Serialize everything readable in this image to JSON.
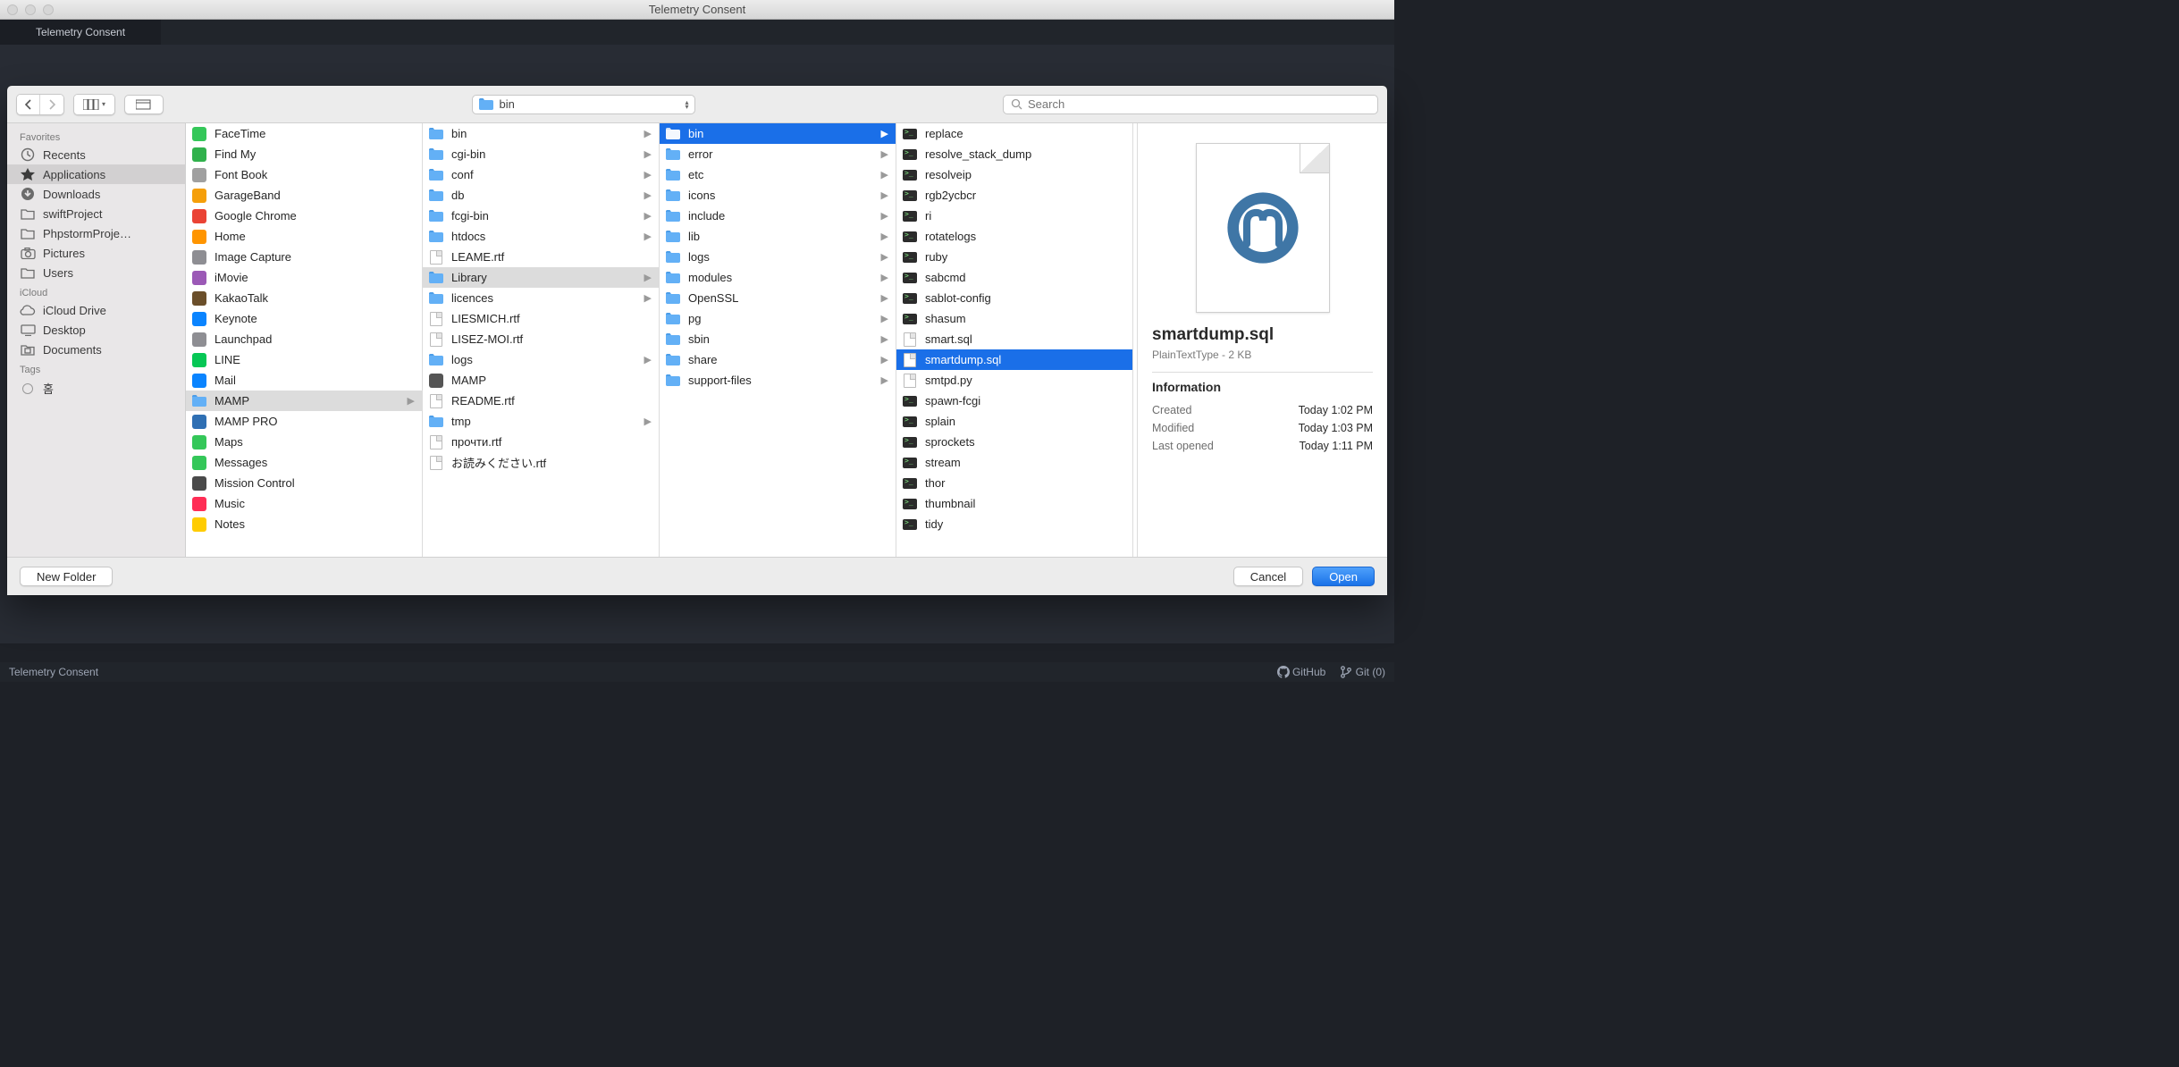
{
  "window": {
    "title": "Telemetry Consent"
  },
  "tabs": [
    {
      "label": "Telemetry Consent"
    }
  ],
  "statusbar": {
    "left": "Telemetry Consent",
    "github": "GitHub",
    "git": "Git (0)"
  },
  "dialog": {
    "path_dropdown": {
      "label": "bin"
    },
    "search": {
      "placeholder": "Search"
    },
    "sidebar": {
      "sections": [
        {
          "header": "Favorites",
          "items": [
            {
              "label": "Recents",
              "icon": "clock"
            },
            {
              "label": "Applications",
              "icon": "apps",
              "selected": true
            },
            {
              "label": "Downloads",
              "icon": "download"
            },
            {
              "label": "swiftProject",
              "icon": "folder"
            },
            {
              "label": "PhpstormProje…",
              "icon": "folder"
            },
            {
              "label": "Pictures",
              "icon": "camera"
            },
            {
              "label": "Users",
              "icon": "folder"
            }
          ]
        },
        {
          "header": "iCloud",
          "items": [
            {
              "label": "iCloud Drive",
              "icon": "cloud"
            },
            {
              "label": "Desktop",
              "icon": "desktop"
            },
            {
              "label": "Documents",
              "icon": "docfolder"
            }
          ]
        },
        {
          "header": "Tags",
          "items": [
            {
              "label": "홈",
              "icon": "tag"
            }
          ]
        }
      ]
    },
    "columns": [
      [
        {
          "label": "FaceTime",
          "type": "app",
          "color": "#34c759"
        },
        {
          "label": "Find My",
          "type": "app",
          "color": "#30b14c"
        },
        {
          "label": "Font Book",
          "type": "app",
          "color": "#a0a0a0"
        },
        {
          "label": "GarageBand",
          "type": "app",
          "color": "#f59f0a"
        },
        {
          "label": "Google Chrome",
          "type": "app",
          "color": "#ea4335"
        },
        {
          "label": "Home",
          "type": "app",
          "color": "#ff9500"
        },
        {
          "label": "Image Capture",
          "type": "app",
          "color": "#8e8e93"
        },
        {
          "label": "iMovie",
          "type": "app",
          "color": "#9b59b6"
        },
        {
          "label": "KakaoTalk",
          "type": "app",
          "color": "#6b4f2a"
        },
        {
          "label": "Keynote",
          "type": "app",
          "color": "#0a84ff"
        },
        {
          "label": "Launchpad",
          "type": "app",
          "color": "#8e8e93"
        },
        {
          "label": "LINE",
          "type": "app",
          "color": "#06c755"
        },
        {
          "label": "Mail",
          "type": "app",
          "color": "#0a84ff"
        },
        {
          "label": "MAMP",
          "type": "folder",
          "selected": "path",
          "hasChildren": true
        },
        {
          "label": "MAMP PRO",
          "type": "app",
          "color": "#2f6fb3"
        },
        {
          "label": "Maps",
          "type": "app",
          "color": "#34c759"
        },
        {
          "label": "Messages",
          "type": "app",
          "color": "#34c759"
        },
        {
          "label": "Mission Control",
          "type": "app",
          "color": "#4a4a4a"
        },
        {
          "label": "Music",
          "type": "app",
          "color": "#ff2d55"
        },
        {
          "label": "Notes",
          "type": "app",
          "color": "#ffcc00"
        }
      ],
      [
        {
          "label": "bin",
          "type": "folder",
          "hasChildren": true
        },
        {
          "label": "cgi-bin",
          "type": "folder",
          "hasChildren": true
        },
        {
          "label": "conf",
          "type": "folder",
          "hasChildren": true
        },
        {
          "label": "db",
          "type": "folder",
          "hasChildren": true
        },
        {
          "label": "fcgi-bin",
          "type": "folder",
          "hasChildren": true
        },
        {
          "label": "htdocs",
          "type": "folder",
          "hasChildren": true
        },
        {
          "label": "LEAME.rtf",
          "type": "doc"
        },
        {
          "label": "Library",
          "type": "folder",
          "hasChildren": true,
          "selected": "path"
        },
        {
          "label": "licences",
          "type": "folder",
          "hasChildren": true
        },
        {
          "label": "LIESMICH.rtf",
          "type": "doc"
        },
        {
          "label": "LISEZ-MOI.rtf",
          "type": "doc"
        },
        {
          "label": "logs",
          "type": "folder",
          "hasChildren": true
        },
        {
          "label": "MAMP",
          "type": "app",
          "color": "#555"
        },
        {
          "label": "README.rtf",
          "type": "doc"
        },
        {
          "label": "tmp",
          "type": "folder",
          "hasChildren": true
        },
        {
          "label": "прочти.rtf",
          "type": "doc"
        },
        {
          "label": "お読みください.rtf",
          "type": "doc"
        }
      ],
      [
        {
          "label": "bin",
          "type": "folder",
          "hasChildren": true,
          "selected": "strong"
        },
        {
          "label": "error",
          "type": "folder",
          "hasChildren": true
        },
        {
          "label": "etc",
          "type": "folder",
          "hasChildren": true
        },
        {
          "label": "icons",
          "type": "folder",
          "hasChildren": true
        },
        {
          "label": "include",
          "type": "folder",
          "hasChildren": true
        },
        {
          "label": "lib",
          "type": "folder",
          "hasChildren": true
        },
        {
          "label": "logs",
          "type": "folder",
          "hasChildren": true
        },
        {
          "label": "modules",
          "type": "folder",
          "hasChildren": true
        },
        {
          "label": "OpenSSL",
          "type": "folder",
          "hasChildren": true
        },
        {
          "label": "pg",
          "type": "folder",
          "hasChildren": true
        },
        {
          "label": "sbin",
          "type": "folder",
          "hasChildren": true
        },
        {
          "label": "share",
          "type": "folder",
          "hasChildren": true
        },
        {
          "label": "support-files",
          "type": "folder",
          "hasChildren": true
        }
      ],
      [
        {
          "label": "replace",
          "type": "exec"
        },
        {
          "label": "resolve_stack_dump",
          "type": "exec"
        },
        {
          "label": "resolveip",
          "type": "exec"
        },
        {
          "label": "rgb2ycbcr",
          "type": "exec"
        },
        {
          "label": "ri",
          "type": "exec"
        },
        {
          "label": "rotatelogs",
          "type": "exec"
        },
        {
          "label": "ruby",
          "type": "exec"
        },
        {
          "label": "sabcmd",
          "type": "exec"
        },
        {
          "label": "sablot-config",
          "type": "exec"
        },
        {
          "label": "shasum",
          "type": "exec"
        },
        {
          "label": "smart.sql",
          "type": "doc"
        },
        {
          "label": "smartdump.sql",
          "type": "doc",
          "selected": "strong"
        },
        {
          "label": "smtpd.py",
          "type": "doc"
        },
        {
          "label": "spawn-fcgi",
          "type": "exec"
        },
        {
          "label": "splain",
          "type": "exec"
        },
        {
          "label": "sprockets",
          "type": "exec"
        },
        {
          "label": "stream",
          "type": "exec"
        },
        {
          "label": "thor",
          "type": "exec"
        },
        {
          "label": "thumbnail",
          "type": "exec"
        },
        {
          "label": "tidy",
          "type": "exec"
        }
      ]
    ],
    "preview": {
      "filename": "smartdump.sql",
      "meta": "PlainTextType - 2 KB",
      "section_header": "Information",
      "info": [
        {
          "k": "Created",
          "v": "Today 1:02 PM"
        },
        {
          "k": "Modified",
          "v": "Today 1:03 PM"
        },
        {
          "k": "Last opened",
          "v": "Today 1:11 PM"
        }
      ]
    },
    "buttons": {
      "new_folder": "New Folder",
      "cancel": "Cancel",
      "open": "Open"
    }
  }
}
